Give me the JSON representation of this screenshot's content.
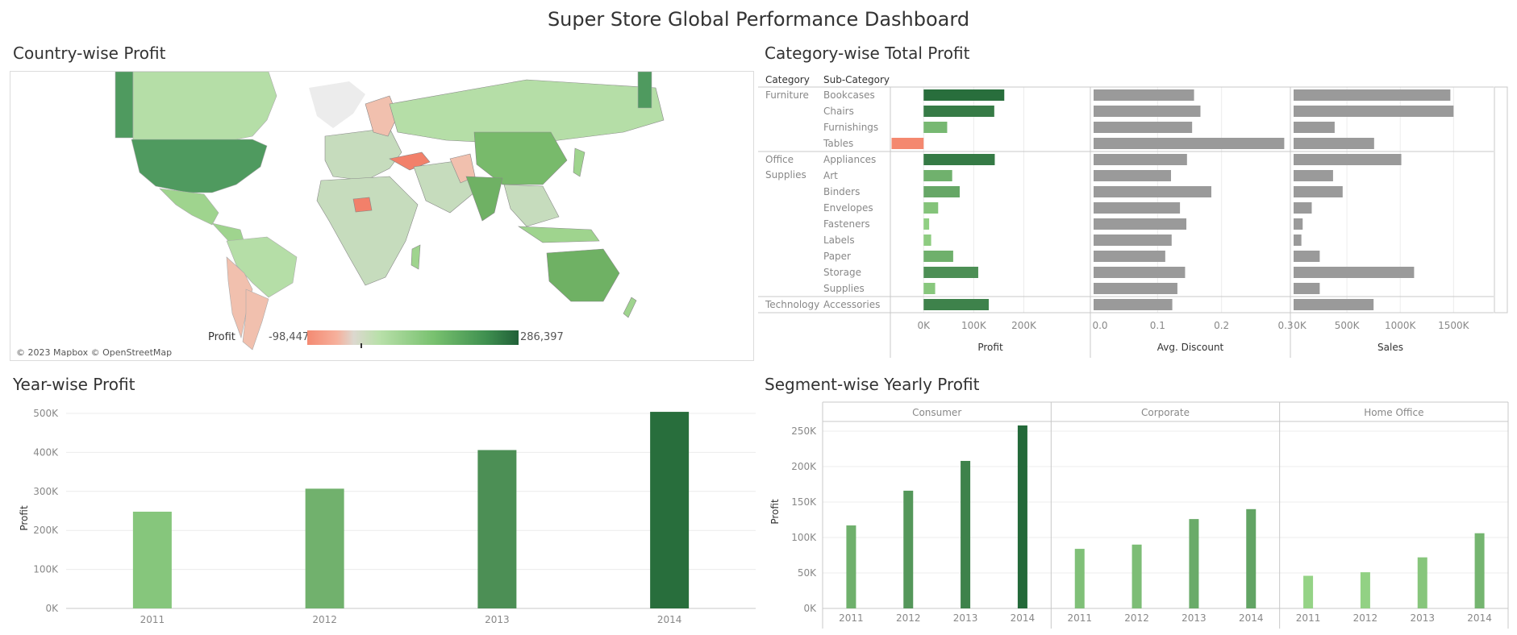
{
  "dashboard": {
    "title": "Super Store Global Performance Dashboard"
  },
  "map": {
    "title": "Country-wise Profit",
    "legend_title": "Profit",
    "legend_min": "-98,447",
    "legend_max": "286,397",
    "credit": "© 2023 Mapbox © OpenStreetMap"
  },
  "category_chart": {
    "title": "Category-wise Total Profit",
    "header_category": "Category",
    "header_subcategory": "Sub-Category",
    "profit_label": "Profit",
    "discount_label": "Avg. Discount",
    "sales_label": "Sales"
  },
  "year_chart": {
    "title": "Year-wise Profit",
    "ylabel": "Profit"
  },
  "segment_chart": {
    "title": "Segment-wise Yearly Profit",
    "ylabel": "Profit"
  },
  "colors": {
    "green_light": "#93d384",
    "green_mid": "#62ab57",
    "green_dark": "#226838",
    "negative": "#f4886f",
    "gray_bar": "#9a9a9a"
  },
  "chart_data": [
    {
      "type": "bar",
      "title": "Category-wise Total Profit",
      "columns": [
        "Profit",
        "Avg. Discount",
        "Sales"
      ],
      "axis_ticks": {
        "Profit": [
          "0K",
          "100K",
          "200K"
        ],
        "Avg. Discount": [
          "0.0",
          "0.1",
          "0.2",
          "0.3"
        ],
        "Sales": [
          "0K",
          "500K",
          "1000K",
          "1500K"
        ]
      },
      "profit_range": [
        -60000,
        320000
      ],
      "discount_range": [
        0,
        0.3
      ],
      "sales_range": [
        0,
        1800000
      ],
      "groups": [
        {
          "category": "Furniture",
          "rows": [
            {
              "sub": "Bookcases",
              "profit": 161000,
              "discount": 0.157,
              "sales": 1470000
            },
            {
              "sub": "Chairs",
              "profit": 141000,
              "discount": 0.167,
              "sales": 1500000
            },
            {
              "sub": "Furnishings",
              "profit": 47000,
              "discount": 0.154,
              "sales": 385000
            },
            {
              "sub": "Tables",
              "profit": -64000,
              "discount": 0.298,
              "sales": 755000
            }
          ]
        },
        {
          "category": "Office Supplies",
          "rows": [
            {
              "sub": "Appliances",
              "profit": 142000,
              "discount": 0.146,
              "sales": 1010000
            },
            {
              "sub": "Art",
              "profit": 57000,
              "discount": 0.121,
              "sales": 370000
            },
            {
              "sub": "Binders",
              "profit": 72000,
              "discount": 0.184,
              "sales": 460000
            },
            {
              "sub": "Envelopes",
              "profit": 29000,
              "discount": 0.135,
              "sales": 170000
            },
            {
              "sub": "Fasteners",
              "profit": 11000,
              "discount": 0.145,
              "sales": 85000
            },
            {
              "sub": "Labels",
              "profit": 15000,
              "discount": 0.122,
              "sales": 73000
            },
            {
              "sub": "Paper",
              "profit": 59000,
              "discount": 0.112,
              "sales": 245000
            },
            {
              "sub": "Storage",
              "profit": 109000,
              "discount": 0.143,
              "sales": 1130000
            },
            {
              "sub": "Supplies",
              "profit": 23000,
              "discount": 0.131,
              "sales": 245000
            }
          ]
        },
        {
          "category": "Technology",
          "rows": [
            {
              "sub": "Accessories",
              "profit": 130000,
              "discount": 0.123,
              "sales": 750000
            }
          ]
        }
      ]
    },
    {
      "type": "bar",
      "title": "Year-wise Profit",
      "categories": [
        "2011",
        "2012",
        "2013",
        "2014"
      ],
      "values": [
        248000,
        307000,
        406000,
        504000
      ],
      "ylabel": "Profit",
      "ylim": [
        0,
        500000
      ],
      "yticks": [
        "0K",
        "100K",
        "200K",
        "300K",
        "400K",
        "500K"
      ]
    },
    {
      "type": "bar",
      "title": "Segment-wise Yearly Profit",
      "panels": [
        "Consumer",
        "Corporate",
        "Home Office"
      ],
      "categories": [
        "2011",
        "2012",
        "2013",
        "2014"
      ],
      "series": [
        {
          "name": "Consumer",
          "values": [
            117000,
            166000,
            208000,
            258000
          ]
        },
        {
          "name": "Corporate",
          "values": [
            84000,
            90000,
            126000,
            140000
          ]
        },
        {
          "name": "Home Office",
          "values": [
            46000,
            51000,
            72000,
            106000
          ]
        }
      ],
      "ylabel": "Profit",
      "ylim": [
        0,
        250000
      ],
      "yticks": [
        "0K",
        "50K",
        "100K",
        "150K",
        "200K",
        "250K"
      ]
    }
  ]
}
